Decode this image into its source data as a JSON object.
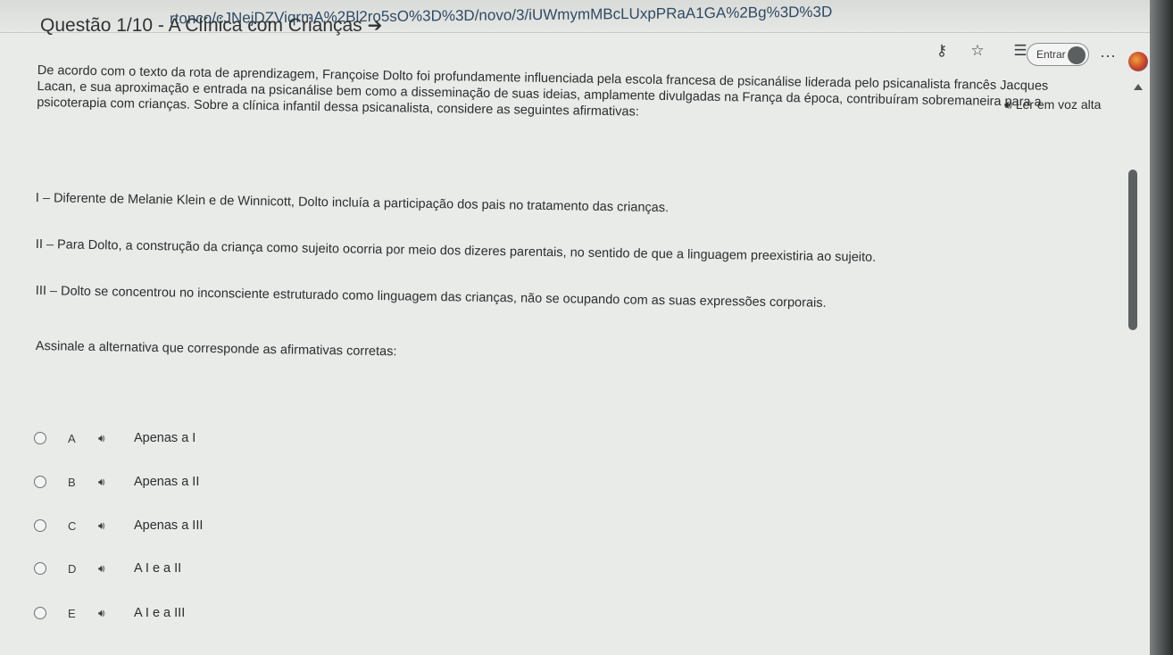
{
  "browser": {
    "url": "rtonco/cJNejDZViqrmA%2Bl2ro5sO%3D%3D/novo/3/iUWmymMBcLUxpPRaA1GA%2Bg%3D%3D",
    "sign_in_label": "Entrar",
    "more_label": "···"
  },
  "page": {
    "title": "Questão 1/10 - A Clínica com Crianças",
    "read_aloud": "Ler em voz alta",
    "prompt_lines": [
      "De acordo com o texto da rota de aprendizagem, Françoise Dolto foi profundamente influenciada pela escola francesa de psicanálise liderada pelo psicanalista francês Jacques",
      "Lacan, e sua aproximação e entrada na psicanálise bem como a disseminação de suas ideias, amplamente divulgadas na França da época, contribuíram sobremaneira para a",
      "psicoterapia com crianças. Sobre a clínica infantil dessa psicanalista, considere as seguintes afirmativas:"
    ],
    "statements": [
      "I – Diferente de Melanie Klein e de Winnicott, Dolto incluía a participação dos pais no tratamento das crianças.",
      "II – Para Dolto, a construção da criança como sujeito ocorria por meio dos dizeres parentais, no sentido de que a linguagem preexistiria ao sujeito.",
      "III – Dolto se concentrou no inconsciente estruturado como linguagem das crianças, não se ocupando com as suas expressões corporais."
    ],
    "instruction": "Assinale a alternativa que corresponde as afirmativas corretas:",
    "options": [
      {
        "letter": "A",
        "text": "Apenas a I"
      },
      {
        "letter": "B",
        "text": "Apenas a II"
      },
      {
        "letter": "C",
        "text": "Apenas a III"
      },
      {
        "letter": "D",
        "text": "A I e a II"
      },
      {
        "letter": "E",
        "text": "A I e a III"
      }
    ]
  },
  "icons": {
    "title_arrow": "arrow-right-icon",
    "read_aloud": "speaker-icon",
    "key": "key-icon",
    "favorite": "star-icon",
    "favorites_list": "favorites-list-icon"
  }
}
